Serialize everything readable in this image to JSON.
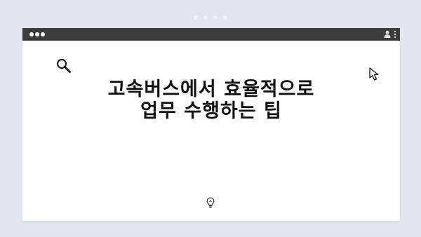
{
  "page": {
    "headline": "고속버스에서 효율적으로 업무 수행하는 팁"
  },
  "icons": {
    "search": "magnifier-icon",
    "cursor": "mouse-pointer-icon",
    "bulb": "lightbulb-icon",
    "profile": "user-profile-icon",
    "menu": "kebab-menu-icon"
  },
  "colors": {
    "background": "#e3e7ed",
    "title_bar": "#3c3c3c",
    "content": "#ffffff",
    "text": "#111111"
  }
}
